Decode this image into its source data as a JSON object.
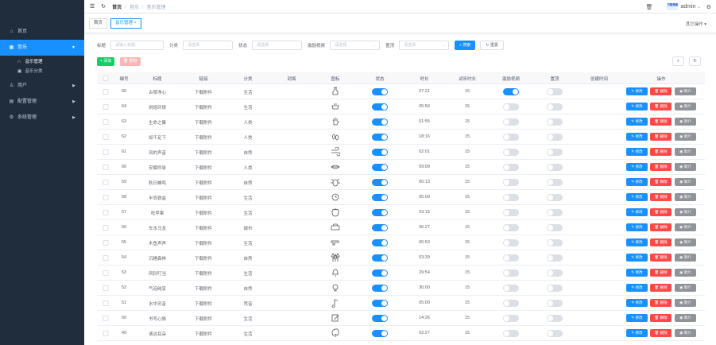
{
  "sidebar": {
    "menu": [
      {
        "label": "首页",
        "icon": "home-icon"
      },
      {
        "label": "音乐",
        "icon": "grid-icon",
        "expanded": true
      },
      {
        "label": "用户",
        "icon": "user-icon"
      },
      {
        "label": "配置管理",
        "icon": "config-icon"
      },
      {
        "label": "系统管理",
        "icon": "system-icon"
      }
    ],
    "submenu": [
      {
        "label": "音乐管理",
        "icon": "headphones-icon",
        "active": true
      },
      {
        "label": "音乐分类",
        "icon": "category-icon"
      }
    ]
  },
  "navbar": {
    "breadcrumb": [
      "首页",
      "音乐",
      "音乐管理"
    ],
    "user": "admin",
    "logo_text": "万能搜索"
  },
  "tags": [
    {
      "label": "首页"
    },
    {
      "label": "音乐管理",
      "close": "×",
      "active": true
    }
  ],
  "more_ops": "其它操作 ▾",
  "filters": [
    {
      "label": "标题",
      "placeholder": "请输入标题",
      "dropdown": false
    },
    {
      "label": "分类",
      "placeholder": "请选择",
      "dropdown": true
    },
    {
      "label": "状态",
      "placeholder": "请选择",
      "dropdown": true
    },
    {
      "label": "激励视频",
      "placeholder": "请选择",
      "dropdown": true
    },
    {
      "label": "置顶",
      "placeholder": "请选择",
      "dropdown": true
    }
  ],
  "buttons": {
    "search": "搜索",
    "reset": "重置",
    "add": "添加",
    "delete": "删除"
  },
  "table": {
    "columns": [
      "编号",
      "标题",
      "链接",
      "分类",
      "封面",
      "图标",
      "状态",
      "时长",
      "试听时长",
      "激励视频",
      "置顶",
      "创建时间",
      "操作"
    ],
    "ops": [
      "修改",
      "删除",
      "简介"
    ],
    "rows": [
      {
        "id": "65",
        "title": "古琴净心",
        "link": "下载附件",
        "category": "生活",
        "icon": "vase",
        "status": true,
        "duration": "07:21",
        "trial": "15",
        "video": true,
        "top": false
      },
      {
        "id": "64",
        "title": "烘焙环境",
        "link": "下载附件",
        "category": "生活",
        "icon": "bowl",
        "status": true,
        "duration": "05:56",
        "trial": "15",
        "video": false,
        "top": false
      },
      {
        "id": "63",
        "title": "生命之聚",
        "link": "下载附件",
        "category": "人类",
        "icon": "hand",
        "status": true,
        "duration": "01:55",
        "trial": "15",
        "video": false,
        "top": false
      },
      {
        "id": "62",
        "title": "如千足下",
        "link": "下载附件",
        "category": "人类",
        "icon": "feet",
        "status": true,
        "duration": "18:16",
        "trial": "15",
        "video": false,
        "top": false
      },
      {
        "id": "61",
        "title": "风的声音",
        "link": "下载附件",
        "category": "自然",
        "icon": "wind",
        "status": true,
        "duration": "02:01",
        "trial": "15",
        "video": false,
        "top": false
      },
      {
        "id": "60",
        "title": "安眠呼吸",
        "link": "下载附件",
        "category": "人类",
        "icon": "lips",
        "status": true,
        "duration": "09:09",
        "trial": "15",
        "video": false,
        "top": false
      },
      {
        "id": "59",
        "title": "秋日蝉鸣",
        "link": "下载附件",
        "category": "自然",
        "icon": "bug",
        "status": true,
        "duration": "00:13",
        "trial": "15",
        "video": false,
        "top": false
      },
      {
        "id": "58",
        "title": "半岛铁盒",
        "link": "下载附件",
        "category": "生活",
        "icon": "clock",
        "status": true,
        "duration": "05:00",
        "trial": "15",
        "video": false,
        "top": false
      },
      {
        "id": "57",
        "title": "吃苹果",
        "link": "下载附件",
        "category": "生活",
        "icon": "apple",
        "status": true,
        "duration": "03:15",
        "trial": "15",
        "video": false,
        "top": false
      },
      {
        "id": "56",
        "title": "车水马龙",
        "link": "下载附件",
        "category": "城市",
        "icon": "car",
        "status": true,
        "duration": "06:27",
        "trial": "15",
        "video": false,
        "top": false
      },
      {
        "id": "55",
        "title": "木鱼声声",
        "link": "下载附件",
        "category": "生活",
        "icon": "gun",
        "status": true,
        "duration": "06:53",
        "trial": "15",
        "video": false,
        "top": false
      },
      {
        "id": "54",
        "title": "沉睡森林",
        "link": "下载附件",
        "category": "自然",
        "icon": "trees",
        "status": true,
        "duration": "03:39",
        "trial": "15",
        "video": false,
        "top": false
      },
      {
        "id": "53",
        "title": "风铃叮当",
        "link": "下载附件",
        "category": "生活",
        "icon": "bell",
        "status": true,
        "duration": "29:54",
        "trial": "15",
        "video": false,
        "top": false
      },
      {
        "id": "52",
        "title": "气泡纯享",
        "link": "下载附件",
        "category": "自然",
        "icon": "bulb",
        "status": true,
        "duration": "30:00",
        "trial": "15",
        "video": false,
        "top": false
      },
      {
        "id": "51",
        "title": "水中灵音",
        "link": "下载附件",
        "category": "梵音",
        "icon": "note",
        "status": true,
        "duration": "05:00",
        "trial": "15",
        "video": false,
        "top": false
      },
      {
        "id": "50",
        "title": "书写心情",
        "link": "下载附件",
        "category": "生活",
        "icon": "pen",
        "status": true,
        "duration": "14:26",
        "trial": "15",
        "video": false,
        "top": false
      },
      {
        "id": "49",
        "title": "清洁耳朵",
        "link": "下载附件",
        "category": "生活",
        "icon": "ear",
        "status": true,
        "duration": "02:27",
        "trial": "15",
        "video": false,
        "top": false
      }
    ]
  }
}
